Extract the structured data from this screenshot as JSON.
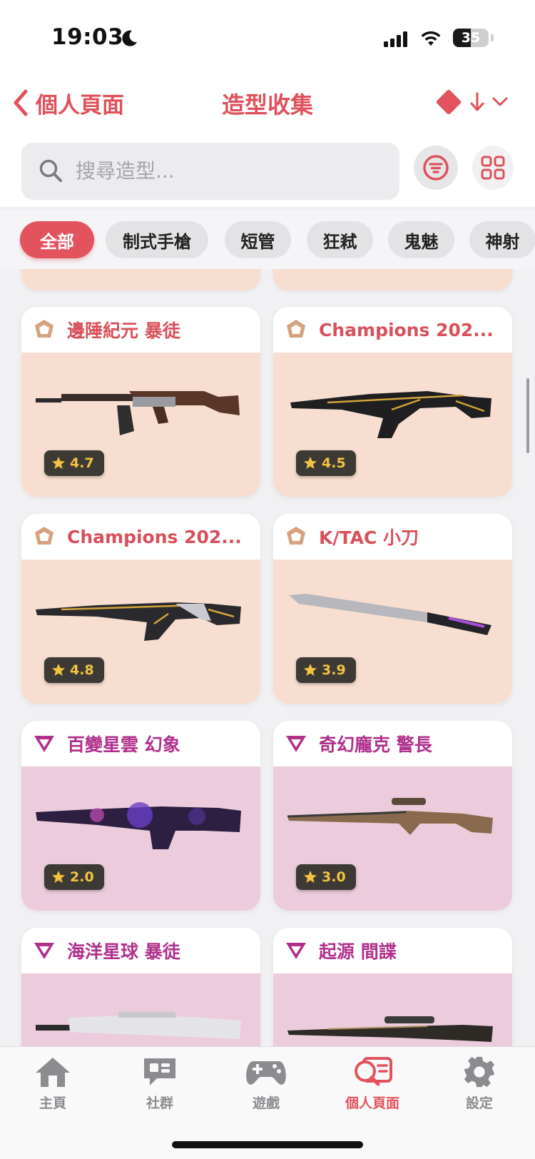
{
  "status_bar": {
    "time": "19:03",
    "battery": "35"
  },
  "nav": {
    "back_label": "個人頁面",
    "title": "造型收集",
    "accent_color": "#e2535e"
  },
  "search": {
    "placeholder": "搜尋造型..."
  },
  "chips": [
    {
      "label": "全部",
      "active": true
    },
    {
      "label": "制式手槍",
      "active": false
    },
    {
      "label": "短管",
      "active": false
    },
    {
      "label": "狂弒",
      "active": false
    },
    {
      "label": "鬼魅",
      "active": false
    },
    {
      "label": "神射",
      "active": false
    }
  ],
  "cards": [
    {
      "name": "邊陲紀元 暴徒",
      "rating": "4.7",
      "tier": "tier-bronze-icon",
      "weapon": "vandal-rifle-icon",
      "name_color": "#d9505a",
      "body_color": "#f7ded0"
    },
    {
      "name": "Champions 202...",
      "rating": "4.5",
      "tier": "tier-bronze-icon",
      "weapon": "phantom-rifle-icon",
      "name_color": "#d9505a",
      "body_color": "#f7ded0"
    },
    {
      "name": "Champions 202...",
      "rating": "4.8",
      "tier": "tier-bronze-icon",
      "weapon": "champion-rifle-icon",
      "name_color": "#d9505a",
      "body_color": "#f7ded0"
    },
    {
      "name": "K/TAC 小刀",
      "rating": "3.9",
      "tier": "tier-bronze-icon",
      "weapon": "knife-icon",
      "name_color": "#d9505a",
      "body_color": "#f7ded0"
    },
    {
      "name": "百變星雲 幻象",
      "rating": "2.0",
      "tier": "tier-purple-icon",
      "weapon": "nebula-rifle-icon",
      "name_color": "#b0308c",
      "body_color": "#ecccdc"
    },
    {
      "name": "奇幻龐克 警長",
      "rating": "3.0",
      "tier": "tier-purple-icon",
      "weapon": "marshal-rifle-icon",
      "name_color": "#b0308c",
      "body_color": "#ecccdc"
    },
    {
      "name": "海洋星球 暴徒",
      "rating": "",
      "tier": "tier-purple-icon",
      "weapon": "white-rifle-icon",
      "name_color": "#b0308c",
      "body_color": "#ecccdc"
    },
    {
      "name": "起源 間諜",
      "rating": "",
      "tier": "tier-purple-icon",
      "weapon": "sniper-rifle-icon",
      "name_color": "#b0308c",
      "body_color": "#ecccdc"
    }
  ],
  "tabs": [
    {
      "label": "主頁",
      "icon": "home-icon",
      "active": false
    },
    {
      "label": "社群",
      "icon": "chat-icon",
      "active": false
    },
    {
      "label": "遊戲",
      "icon": "gamepad-icon",
      "active": false
    },
    {
      "label": "個人頁面",
      "icon": "profile-search-icon",
      "active": true
    },
    {
      "label": "設定",
      "icon": "gear-icon",
      "active": false
    }
  ]
}
